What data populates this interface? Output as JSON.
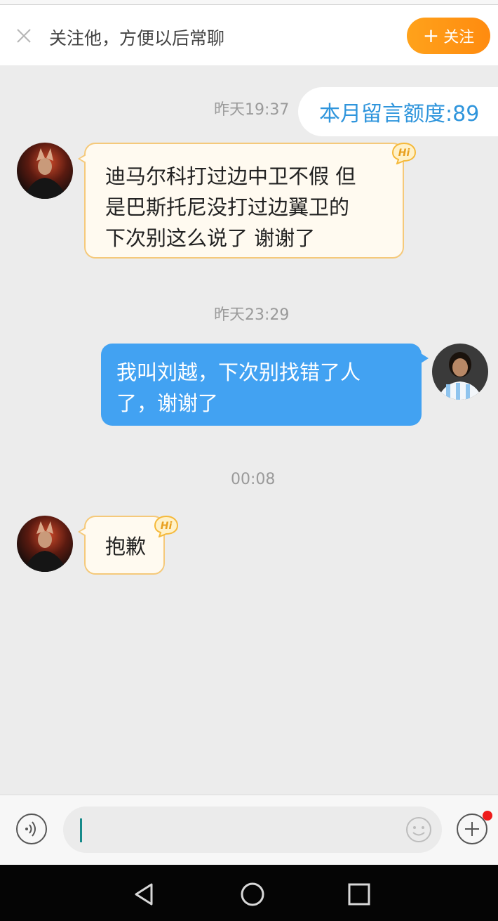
{
  "follow_bar": {
    "text": "关注他，方便以后常聊",
    "button_label": "关注",
    "close_icon": "close-icon",
    "plus_icon": "plus-icon"
  },
  "quota": {
    "text": "本月留言额度:89"
  },
  "messages": [
    {
      "time": "昨天19:37",
      "direction": "in",
      "lines": [
        "迪马尔科打过边中卫不假 但",
        "是巴斯托尼没打过边翼卫的",
        "下次别这么说了 谢谢了"
      ],
      "badge": "Hi"
    },
    {
      "time": "昨天23:29",
      "direction": "out",
      "lines": [
        "我叫刘越，下次别找错了人",
        "了，谢谢了"
      ]
    },
    {
      "time": "00:08",
      "direction": "in",
      "lines": [
        "抱歉"
      ],
      "badge": "Hi"
    }
  ],
  "input_bar": {
    "value": "",
    "voice_icon": "voice-icon",
    "emoji_icon": "emoji-icon",
    "add_icon": "add-icon"
  },
  "nav": {
    "back_icon": "back-icon",
    "home_icon": "home-icon",
    "recent_icon": "recent-apps-icon"
  },
  "colors": {
    "accent_orange": "#ff9a16",
    "bubble_blue": "#42a2f2",
    "quota_blue": "#2f95dc",
    "bubble_in_bg": "#fffaf0",
    "bubble_in_border": "#f5c97a"
  }
}
